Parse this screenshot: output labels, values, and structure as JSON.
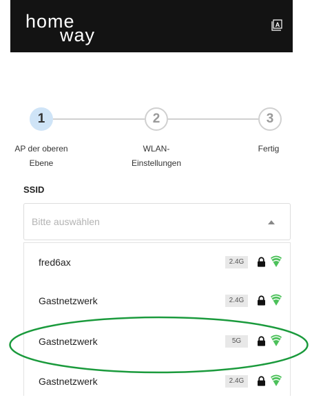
{
  "header": {
    "logo_line1": "home",
    "logo_line2": "way",
    "language_button_letter": "A",
    "background_color": "#131313"
  },
  "stepper": {
    "active_color": "#cfe4f7",
    "steps": [
      {
        "number": "1",
        "label": "AP der oberen\nEbene",
        "state": "active"
      },
      {
        "number": "2",
        "label": "WLAN-\nEinstellungen",
        "state": "inactive"
      },
      {
        "number": "3",
        "label": "Fertig",
        "state": "inactive"
      }
    ]
  },
  "ssid": {
    "label": "SSID",
    "placeholder": "Bitte auswählen",
    "dropdown_open": true
  },
  "networks": [
    {
      "name": "fred6ax",
      "band": "2.4G",
      "secured": true,
      "signal": "full"
    },
    {
      "name": "Gastnetzwerk",
      "band": "2.4G",
      "secured": true,
      "signal": "full"
    },
    {
      "name": "Gastnetzwerk",
      "band": "5G",
      "secured": true,
      "signal": "full",
      "highlighted": true
    },
    {
      "name": "Gastnetzwerk",
      "band": "2.4G",
      "secured": true,
      "signal": "full"
    }
  ],
  "colors": {
    "wifi_signal": "#4cc15a",
    "highlight_ellipse": "#1a9a3c"
  },
  "icons": {
    "lock": "lock-icon",
    "wifi": "wifi-icon",
    "language": "language-icon",
    "caret": "caret-up-icon"
  }
}
